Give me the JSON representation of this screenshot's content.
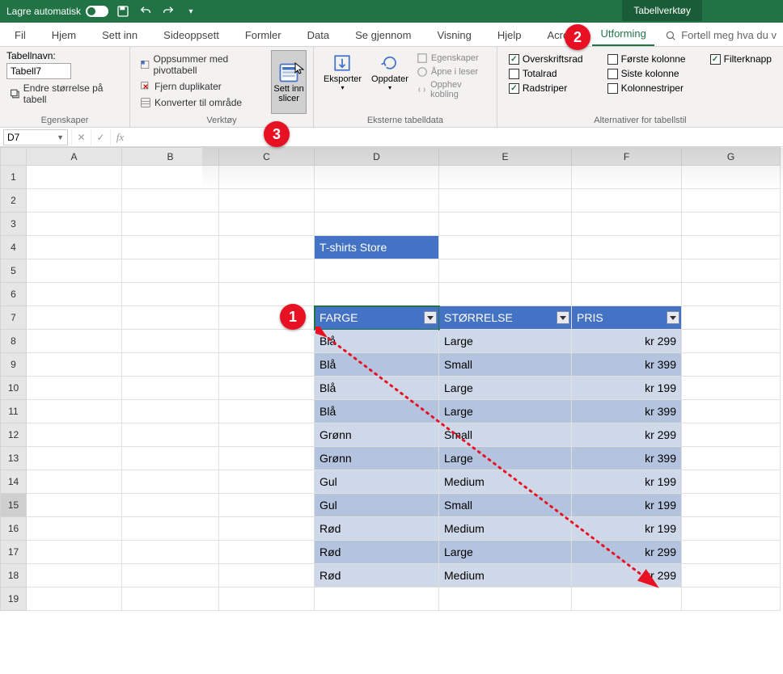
{
  "titlebar": {
    "autosave": "Lagre automatisk"
  },
  "context_tab": "Tabellverktøy",
  "tabs": {
    "fil": "Fil",
    "hjem": "Hjem",
    "settinn": "Sett inn",
    "sideoppsett": "Sideoppsett",
    "formler": "Formler",
    "data": "Data",
    "segjennom": "Se gjennom",
    "visning": "Visning",
    "hjelp": "Hjelp",
    "acrobat": "Acrob",
    "utforming": "Utforming"
  },
  "tell_me": "Fortell meg hva du v",
  "ribbon": {
    "egenskaper": {
      "label": "Egenskaper",
      "tablename_label": "Tabellnavn:",
      "tablename_value": "Tabell7",
      "resize": "Endre størrelse på tabell"
    },
    "verktoy": {
      "label": "Verktøy",
      "pivot": "Oppsummer med pivottabell",
      "dup": "Fjern duplikater",
      "range": "Konverter til område",
      "slicer_line1": "Sett inn",
      "slicer_line2": "slicer"
    },
    "eksterne": {
      "label": "Eksterne tabelldata",
      "eksporter": "Eksporter",
      "oppdater": "Oppdater",
      "egensk": "Egenskaper",
      "apne": "Åpne i leser",
      "opphev": "Opphev kobling"
    },
    "alternativer": {
      "label": "Alternativer for tabellstil",
      "overskriftsrad": "Overskriftsrad",
      "totalrad": "Totalrad",
      "radstriper": "Radstriper",
      "forste": "Første kolonne",
      "siste": "Siste kolonne",
      "kolstriper": "Kolonnestriper",
      "filterknapp": "Filterknapp"
    }
  },
  "namebox": "D7",
  "columns": [
    "A",
    "B",
    "C",
    "D",
    "E",
    "F",
    "G"
  ],
  "title_cell": "T-shirts Store",
  "table": {
    "headers": {
      "farge": "FARGE",
      "storrelse": "STØRRELSE",
      "pris": "PRIS"
    },
    "rows": [
      {
        "farge": "Blå",
        "storrelse": "Large",
        "pris": "kr 299"
      },
      {
        "farge": "Blå",
        "storrelse": "Small",
        "pris": "kr 399"
      },
      {
        "farge": "Blå",
        "storrelse": "Large",
        "pris": "kr 199"
      },
      {
        "farge": "Blå",
        "storrelse": "Large",
        "pris": "kr 399"
      },
      {
        "farge": "Grønn",
        "storrelse": "Small",
        "pris": "kr 299"
      },
      {
        "farge": "Grønn",
        "storrelse": "Large",
        "pris": "kr 399"
      },
      {
        "farge": "Gul",
        "storrelse": "Medium",
        "pris": "kr 199"
      },
      {
        "farge": "Gul",
        "storrelse": "Small",
        "pris": "kr 199"
      },
      {
        "farge": "Rød",
        "storrelse": "Medium",
        "pris": "kr 199"
      },
      {
        "farge": "Rød",
        "storrelse": "Large",
        "pris": "kr 299"
      },
      {
        "farge": "Rød",
        "storrelse": "Medium",
        "pris": "kr 299"
      }
    ]
  },
  "callouts": {
    "c1": "1",
    "c2": "2",
    "c3": "3"
  }
}
